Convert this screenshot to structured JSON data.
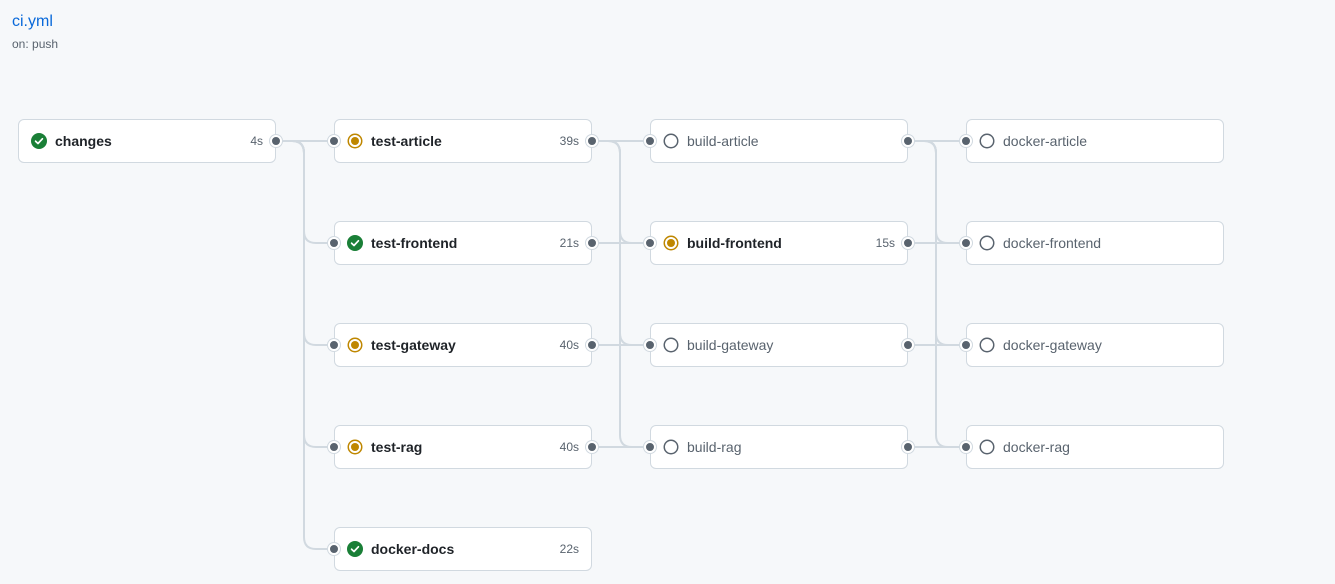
{
  "workflow": {
    "title": "ci.yml",
    "trigger": "on: push"
  },
  "colors": {
    "success": "#1a7f37",
    "in_progress": "#bf8700",
    "queued": "#59636e",
    "edge": "#d1d9e0",
    "link": "#0969da"
  },
  "jobs": [
    {
      "id": "changes",
      "name": "changes",
      "duration": "4s",
      "status": "success",
      "icon": "check-circle-icon"
    },
    {
      "id": "test-article",
      "name": "test-article",
      "duration": "39s",
      "status": "in_progress",
      "icon": "in-progress-icon"
    },
    {
      "id": "test-frontend",
      "name": "test-frontend",
      "duration": "21s",
      "status": "success",
      "icon": "check-circle-icon"
    },
    {
      "id": "test-gateway",
      "name": "test-gateway",
      "duration": "40s",
      "status": "in_progress",
      "icon": "in-progress-icon"
    },
    {
      "id": "test-rag",
      "name": "test-rag",
      "duration": "40s",
      "status": "in_progress",
      "icon": "in-progress-icon"
    },
    {
      "id": "docker-docs",
      "name": "docker-docs",
      "duration": "22s",
      "status": "success",
      "icon": "check-circle-icon"
    },
    {
      "id": "build-article",
      "name": "build-article",
      "duration": "",
      "status": "queued",
      "icon": "queued-circle-icon"
    },
    {
      "id": "build-frontend",
      "name": "build-frontend",
      "duration": "15s",
      "status": "in_progress",
      "icon": "in-progress-icon"
    },
    {
      "id": "build-gateway",
      "name": "build-gateway",
      "duration": "",
      "status": "queued",
      "icon": "queued-circle-icon"
    },
    {
      "id": "build-rag",
      "name": "build-rag",
      "duration": "",
      "status": "queued",
      "icon": "queued-circle-icon"
    },
    {
      "id": "docker-article",
      "name": "docker-article",
      "duration": "",
      "status": "queued",
      "icon": "queued-circle-icon"
    },
    {
      "id": "docker-frontend",
      "name": "docker-frontend",
      "duration": "",
      "status": "queued",
      "icon": "queued-circle-icon"
    },
    {
      "id": "docker-gateway",
      "name": "docker-gateway",
      "duration": "",
      "status": "queued",
      "icon": "queued-circle-icon"
    },
    {
      "id": "docker-rag",
      "name": "docker-rag",
      "duration": "",
      "status": "queued",
      "icon": "queued-circle-icon"
    }
  ],
  "dependencies": [
    [
      "changes",
      "test-article"
    ],
    [
      "changes",
      "test-frontend"
    ],
    [
      "changes",
      "test-gateway"
    ],
    [
      "changes",
      "test-rag"
    ],
    [
      "changes",
      "docker-docs"
    ],
    [
      "test-article",
      "build-article"
    ],
    [
      "test-article",
      "build-frontend"
    ],
    [
      "test-article",
      "build-gateway"
    ],
    [
      "test-article",
      "build-rag"
    ],
    [
      "test-frontend",
      "build-frontend"
    ],
    [
      "test-gateway",
      "build-gateway"
    ],
    [
      "test-rag",
      "build-rag"
    ],
    [
      "build-article",
      "docker-article"
    ],
    [
      "build-article",
      "docker-frontend"
    ],
    [
      "build-article",
      "docker-gateway"
    ],
    [
      "build-article",
      "docker-rag"
    ],
    [
      "build-frontend",
      "docker-frontend"
    ],
    [
      "build-gateway",
      "docker-gateway"
    ],
    [
      "build-rag",
      "docker-rag"
    ]
  ]
}
